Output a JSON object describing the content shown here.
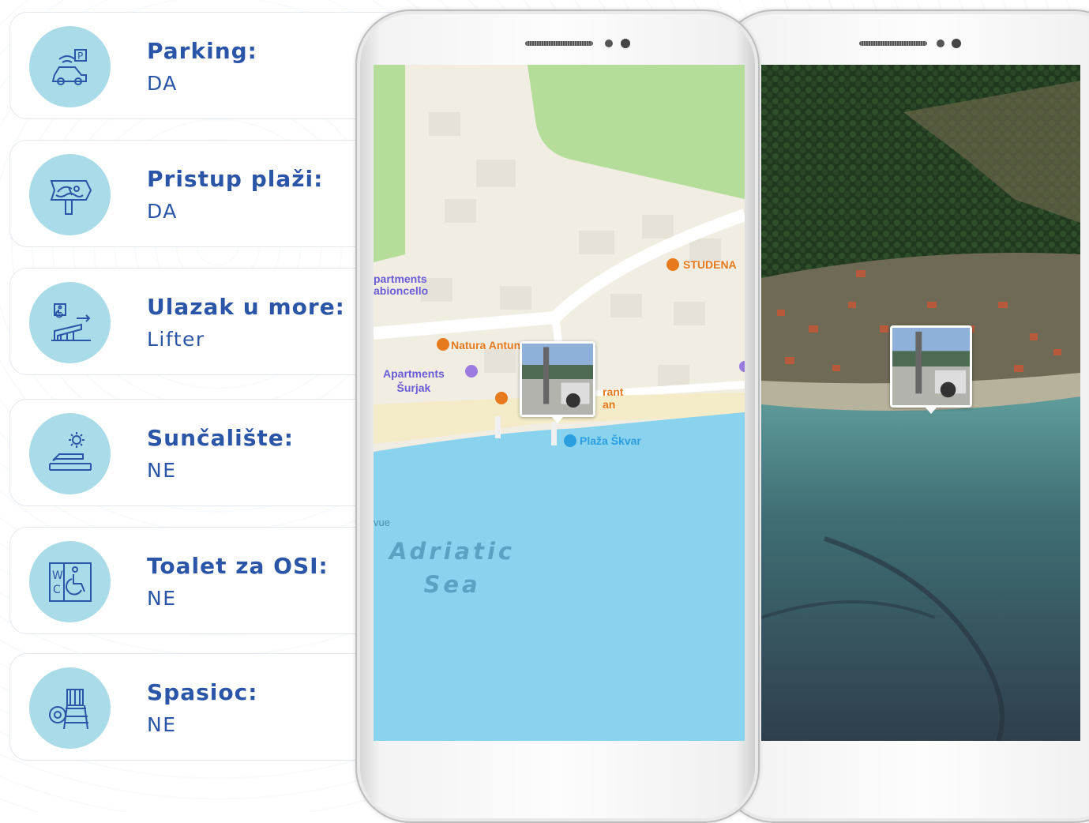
{
  "features": [
    {
      "icon": "parking-icon",
      "label": "Parking:",
      "value": "DA"
    },
    {
      "icon": "beach-access-sign-icon",
      "label": "Pristup plaži:",
      "value": "DA"
    },
    {
      "icon": "accessible-ramp-icon",
      "label": "Ulazak u more:",
      "value": "Lifter"
    },
    {
      "icon": "sunbed-icon",
      "label": "Sunčalište:",
      "value": "NE"
    },
    {
      "icon": "accessible-wc-icon",
      "label": "Toalet za OSI:",
      "value": "NE"
    },
    {
      "icon": "lifeguard-chair-icon",
      "label": "Spasioc:",
      "value": "NE"
    }
  ],
  "map": {
    "labels": {
      "apartments_top": "partments\nabioncello",
      "natura": "Natura Antunovic",
      "apartments_surjak": "Apartments\nŠurjak",
      "restaurant": "rant\nan",
      "studena": "STUDENA",
      "plaza": "Plaža Škvar",
      "vue": "vue",
      "sea": "Adriatic\nSea"
    }
  },
  "colors": {
    "accent": "#2b56a7",
    "icon_bg": "#a9dbe8",
    "sea": "#8ad3ef",
    "land": "#f1ede3",
    "park": "#b3dd99"
  }
}
